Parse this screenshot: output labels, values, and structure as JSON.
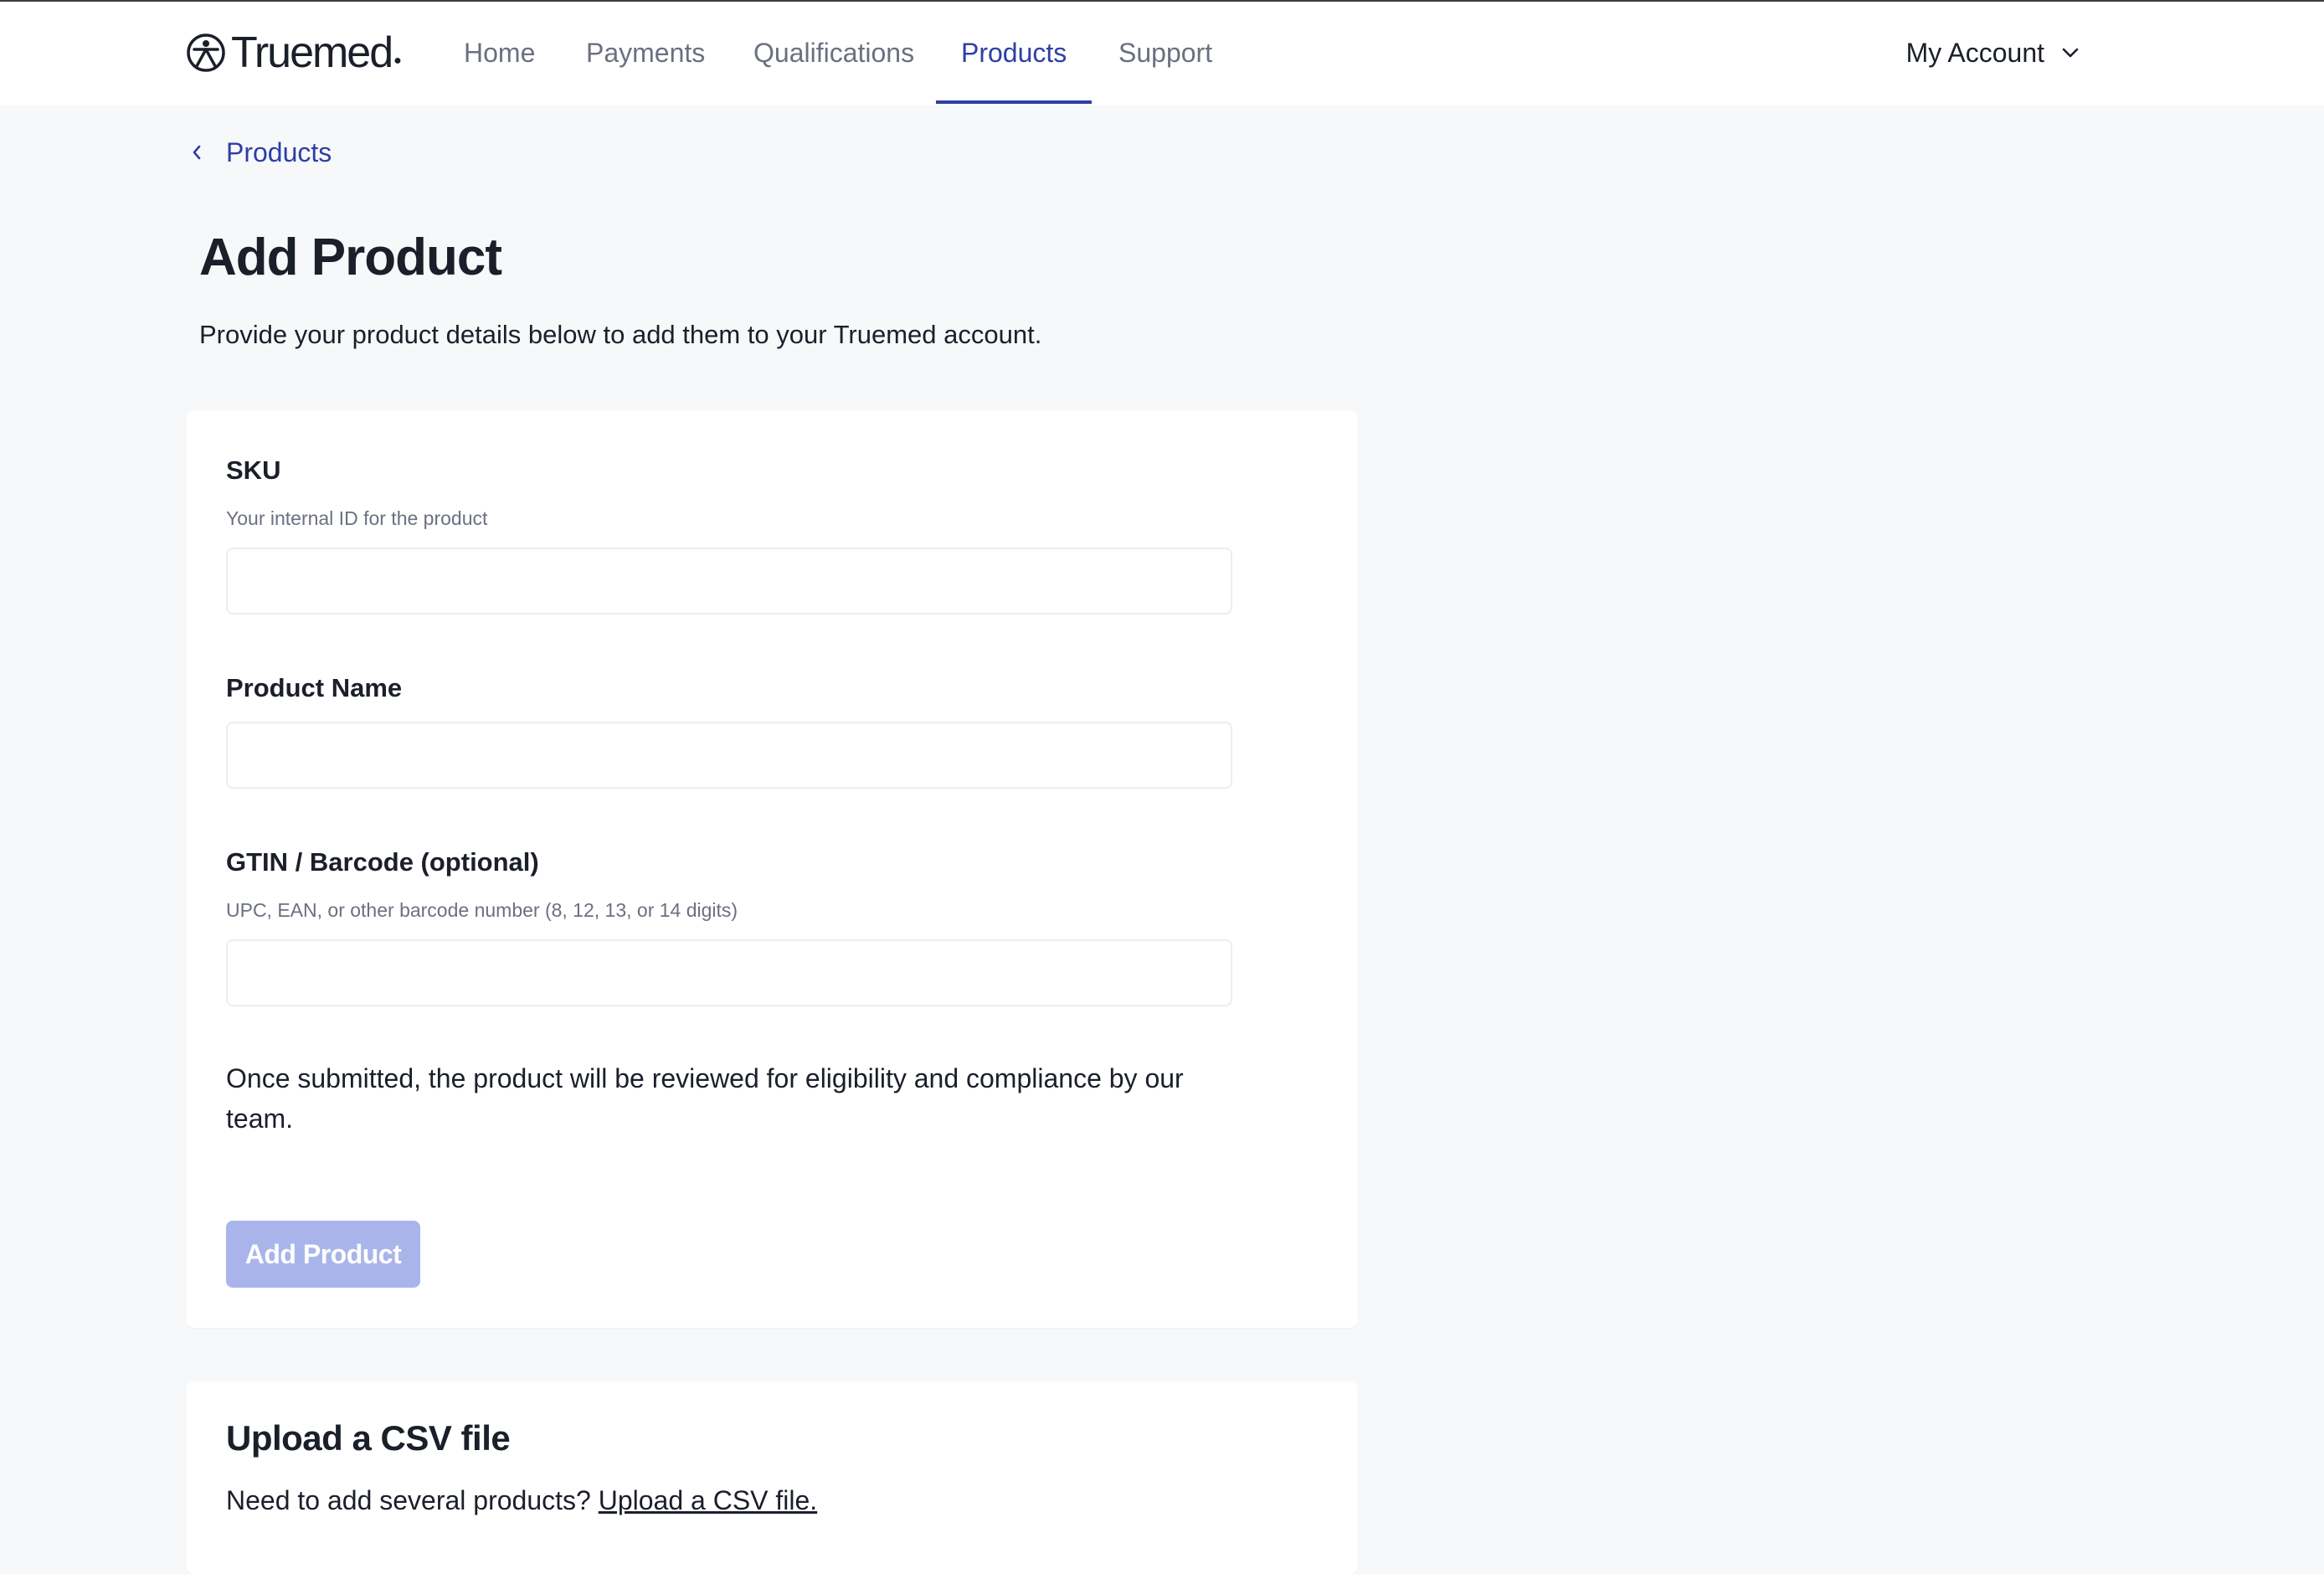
{
  "brand": {
    "name": "Truemed",
    "logo_icon": "truemed-logo-icon"
  },
  "nav": {
    "items": [
      {
        "label": "Home",
        "active": false
      },
      {
        "label": "Payments",
        "active": false
      },
      {
        "label": "Qualifications",
        "active": false
      },
      {
        "label": "Products",
        "active": true
      },
      {
        "label": "Support",
        "active": false
      }
    ],
    "account_label": "My Account",
    "account_icon": "chevron-down-icon"
  },
  "breadcrumb": {
    "label": "Products",
    "icon": "chevron-left-icon"
  },
  "page": {
    "title": "Add Product",
    "subtitle": "Provide your product details below to add them to your Truemed account."
  },
  "form": {
    "sku": {
      "label": "SKU",
      "help": "Your internal ID for the product",
      "value": ""
    },
    "product_name": {
      "label": "Product Name",
      "value": ""
    },
    "gtin": {
      "label": "GTIN / Barcode (optional)",
      "help": "UPC, EAN, or other barcode number (8, 12, 13, or 14 digits)",
      "value": ""
    },
    "note": "Once submitted, the product will be reviewed for eligibility and compliance by our team.",
    "submit_label": "Add Product",
    "submit_disabled": true
  },
  "csv": {
    "title": "Upload a CSV file",
    "prompt": "Need to add several products?",
    "link_label": "Upload a CSV file."
  },
  "colors": {
    "accent": "#2d3fa6",
    "page_background": "#f7f8fa",
    "card_background": "#ffffff",
    "disabled_button": "#a9b5ea",
    "muted_text": "#6b7080",
    "text": "#1b1f2a"
  }
}
